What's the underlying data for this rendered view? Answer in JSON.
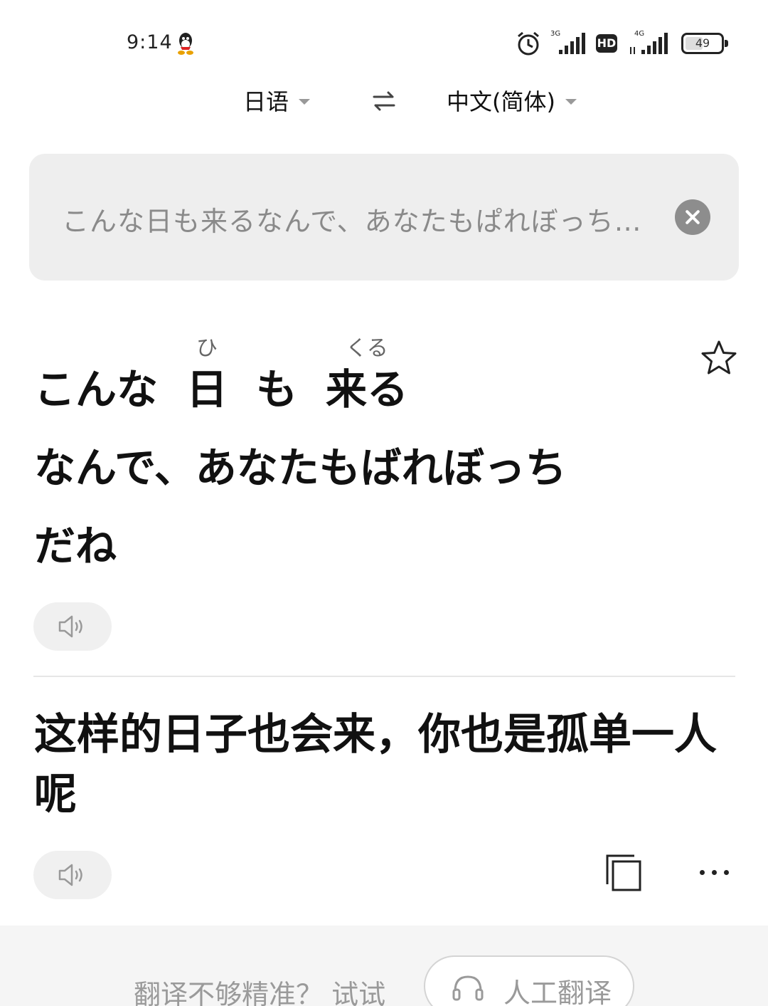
{
  "status_bar": {
    "time": "9:14",
    "signal1_label": "3G",
    "hd_label": "HD",
    "signal2_label": "4G",
    "battery_level": "49",
    "battery_fraction": 0.49
  },
  "language_bar": {
    "source_lang": "日语",
    "target_lang": "中文(简体)",
    "icons": {
      "swap": "swap-arrows-icon",
      "dropdown": "caret-down-icon"
    }
  },
  "input": {
    "text": "こんな日も来るなんで、あなたもぱれぼっち…"
  },
  "source_result": {
    "line1": [
      {
        "base": "こんな",
        "ruby": ""
      },
      {
        "base": "日",
        "ruby": "ひ"
      },
      {
        "base": "も",
        "ruby": ""
      },
      {
        "base": "来る",
        "ruby": "くる"
      }
    ],
    "line2": "なんで、あなたもばれぼっち",
    "line3": "だね"
  },
  "translation": {
    "text": "这样的日子也会来，你也是孤单一人呢"
  },
  "bottom": {
    "hint": "翻译不够精准？ 试试",
    "human_button_label": "人工翻译"
  },
  "colors": {
    "input_bg": "#eeeeee",
    "clear_button": "#8d8d8d",
    "hint_text": "#9a9a9a"
  }
}
